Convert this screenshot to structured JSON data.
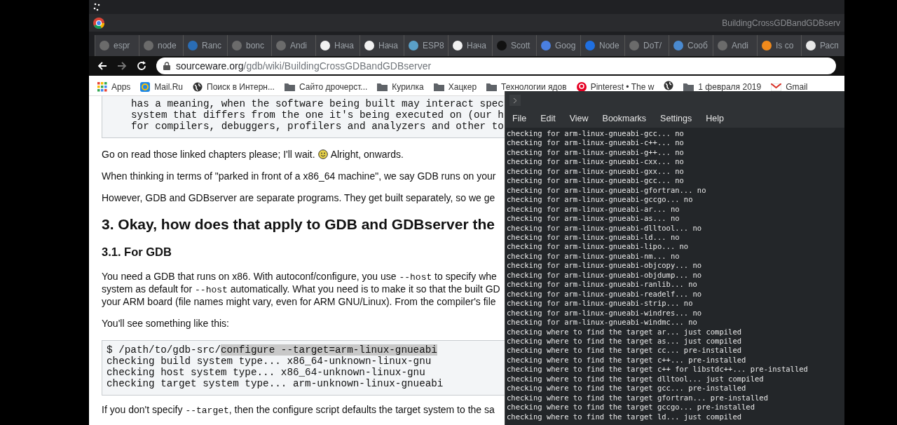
{
  "window": {
    "title": "BuildingCrossGDBandGDBserv"
  },
  "tabs": [
    {
      "label": "espr",
      "color": "#6b6b6b"
    },
    {
      "label": "node",
      "color": "#6b6b6b"
    },
    {
      "label": "Ranc",
      "color": "#2a6db5"
    },
    {
      "label": "bonc",
      "color": "#6b6b6b"
    },
    {
      "label": "Andi",
      "color": "#6b6b6b"
    },
    {
      "label": "Нача",
      "color": "#f1f1f1"
    },
    {
      "label": "Нача",
      "color": "#f1f1f1"
    },
    {
      "label": "ESP8",
      "color": "#5aa0c8"
    },
    {
      "label": "Нача",
      "color": "#f1f1f1"
    },
    {
      "label": "Scott",
      "color": "#111111"
    },
    {
      "label": "Goog",
      "color": "#4a7fe0"
    },
    {
      "label": "Node",
      "color": "#1f6fe0"
    },
    {
      "label": "DoT/",
      "color": "#6b6b6b"
    },
    {
      "label": "Сооб",
      "color": "#4a8ad0"
    },
    {
      "label": "Andi",
      "color": "#6b6b6b"
    },
    {
      "label": "Is co",
      "color": "#f08a1c"
    },
    {
      "label": "Расп",
      "color": "#e8e8e8"
    }
  ],
  "address_bar": {
    "domain": "sourceware.org",
    "path": "/gdb/wiki/BuildingCrossGDBandGDBserver"
  },
  "bookmarks": [
    {
      "kind": "apps",
      "label": "Apps"
    },
    {
      "kind": "mail",
      "label": "Mail.Ru"
    },
    {
      "kind": "globe",
      "label": "Поиск в Интерн..."
    },
    {
      "kind": "folder",
      "label": "Сайто дрочерст..."
    },
    {
      "kind": "folder",
      "label": "Курилка"
    },
    {
      "kind": "folder",
      "label": "Хацкер"
    },
    {
      "kind": "folder",
      "label": "Технологии ядов"
    },
    {
      "kind": "pin",
      "label": "Pinterest • The w"
    },
    {
      "kind": "globe"
    },
    {
      "kind": "folder",
      "label": "1 февраля 2019"
    },
    {
      "kind": "gmail",
      "label": "Gmail"
    }
  ],
  "page": {
    "quote_lines": [
      "has a meaning, when the software being built may interact spec",
      "system that differs from the one it's being executed on (our h",
      "for compilers, debuggers, profilers and analyzers and other to"
    ],
    "wait_text": "Go on read those linked chapters please; I'll wait.",
    "onwards_text": "Alright, onwards.",
    "paragraph_1": "When thinking in terms of \"parked in front of a x86_64 machine\", we say GDB runs on your",
    "paragraph_2": "However, GDB and GDBserver are separate programs. They get built separately, so we ge",
    "heading": "3. Okay, how does that apply to GDB and GDBserver the",
    "subheading": "3.1. For GDB",
    "paragraph_3": [
      [
        {
          "kind": "text",
          "text": "You need a GDB that runs on x86. With autoconf/configure, you use "
        },
        {
          "kind": "code",
          "text": "--host"
        },
        {
          "kind": "text",
          "text": " to specify whe"
        }
      ],
      [
        {
          "kind": "text",
          "text": "system as default for "
        },
        {
          "kind": "code",
          "text": "--host"
        },
        {
          "kind": "text",
          "text": " automatically. What you need is to make it so that the built GD"
        }
      ],
      [
        {
          "kind": "text",
          "text": "your ARM board (file names might vary, even for ARM GNU/Linux). From the compiler's file"
        }
      ]
    ],
    "paragraph_4": "You'll see something like this:",
    "code_lines": [
      [
        {
          "kind": "text",
          "text": "$ /path/to/gdb-src/"
        },
        {
          "kind": "highlight",
          "text": "configure --target=arm-linux-gnueabi"
        }
      ],
      [
        {
          "kind": "text",
          "text": "checking build system type... x86_64-unknown-linux-gnu"
        }
      ],
      [
        {
          "kind": "text",
          "text": "checking host system type... x86_64-unknown-linux-gnu"
        }
      ],
      [
        {
          "kind": "text",
          "text": "checking target system type... arm-unknown-linux-gnueabi"
        }
      ]
    ],
    "paragraph_5": [
      {
        "kind": "text",
        "text": "If you don't specify "
      },
      {
        "kind": "code",
        "text": "--target"
      },
      {
        "kind": "text",
        "text": ", then the configure script defaults the target system to the sa"
      }
    ]
  },
  "terminal": {
    "menu": [
      "File",
      "Edit",
      "View",
      "Bookmarks",
      "Settings",
      "Help"
    ],
    "lines": [
      "checking for arm-linux-gnueabi-gcc... no",
      "checking for arm-linux-gnueabi-c++... no",
      "checking for arm-linux-gnueabi-g++... no",
      "checking for arm-linux-gnueabi-cxx... no",
      "checking for arm-linux-gnueabi-gxx... no",
      "checking for arm-linux-gnueabi-gcc... no",
      "checking for arm-linux-gnueabi-gfortran... no",
      "checking for arm-linux-gnueabi-gccgo... no",
      "checking for arm-linux-gnueabi-ar... no",
      "checking for arm-linux-gnueabi-as... no",
      "checking for arm-linux-gnueabi-dlltool... no",
      "checking for arm-linux-gnueabi-ld... no",
      "checking for arm-linux-gnueabi-lipo... no",
      "checking for arm-linux-gnueabi-nm... no",
      "checking for arm-linux-gnueabi-objcopy... no",
      "checking for arm-linux-gnueabi-objdump... no",
      "checking for arm-linux-gnueabi-ranlib... no",
      "checking for arm-linux-gnueabi-readelf... no",
      "checking for arm-linux-gnueabi-strip... no",
      "checking for arm-linux-gnueabi-windres... no",
      "checking for arm-linux-gnueabi-windmc... no",
      "checking where to find the target ar... just compiled",
      "checking where to find the target as... just compiled",
      "checking where to find the target cc... pre-installed",
      "checking where to find the target c++... pre-installed",
      "checking where to find the target c++ for libstdc++... pre-installed",
      "checking where to find the target dlltool... just compiled",
      "checking where to find the target gcc... pre-installed",
      "checking where to find the target gfortran... pre-installed",
      "checking where to find the target gccgo... pre-installed",
      "checking where to find the target ld... just compiled"
    ]
  }
}
